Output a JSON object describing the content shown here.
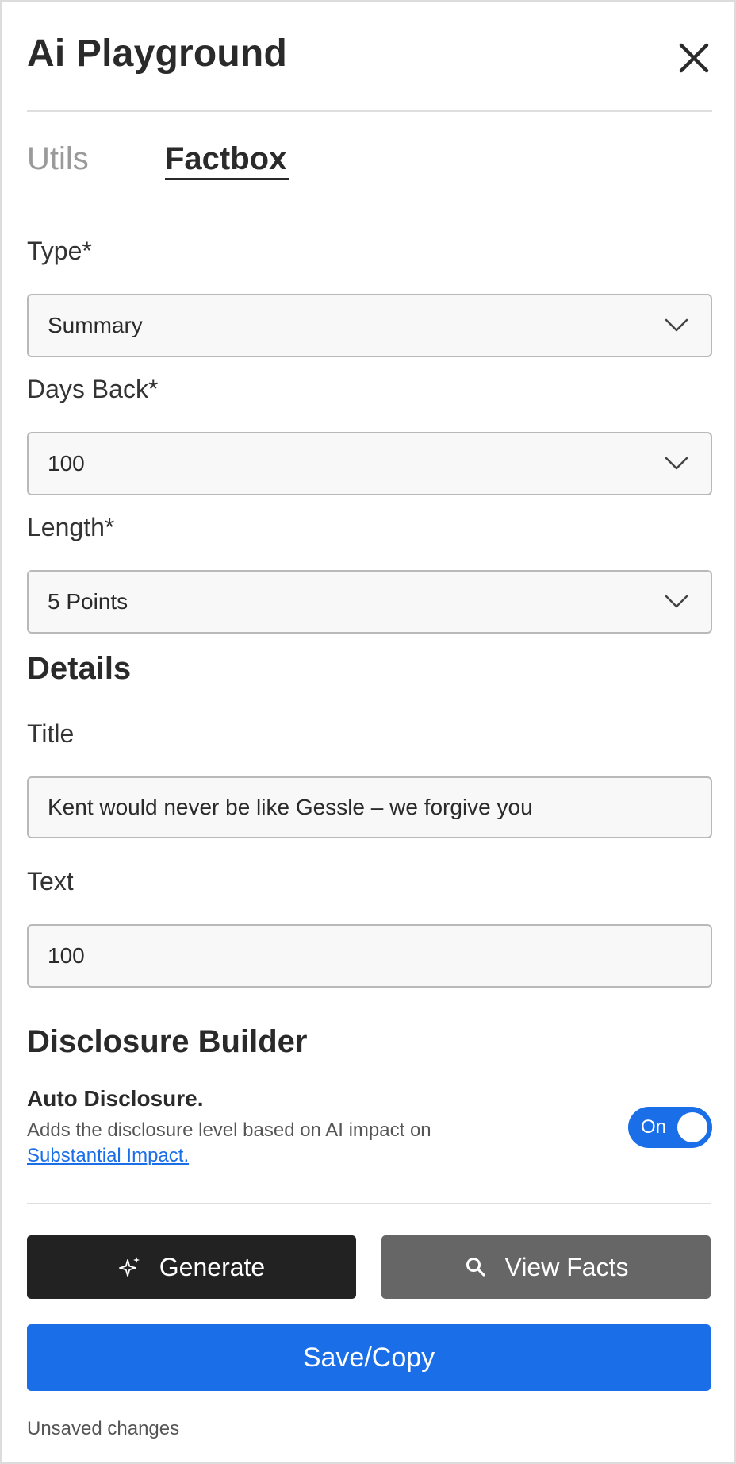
{
  "header": {
    "title": "Ai Playground",
    "close_icon": "close-icon"
  },
  "tabs": [
    {
      "label": "Utils",
      "active": false
    },
    {
      "label": "Factbox",
      "active": true
    }
  ],
  "form": {
    "type": {
      "label": "Type*",
      "value": "Summary"
    },
    "days_back": {
      "label": "Days Back*",
      "value": "100"
    },
    "length": {
      "label": "Length*",
      "value": "5 Points"
    }
  },
  "details": {
    "heading": "Details",
    "title_field": {
      "label": "Title",
      "value": "Kent would never be like Gessle – we forgive you"
    },
    "text_field": {
      "label": "Text",
      "value": "100"
    }
  },
  "disclosure": {
    "heading": "Disclosure Builder",
    "auto_label": "Auto Disclosure.",
    "description": "Adds the disclosure level based on AI impact on",
    "link_text": "Substantial Impact.",
    "toggle_label": "On",
    "toggle_on": true
  },
  "actions": {
    "generate_label": "Generate",
    "generate_icon": "sparkle-icon",
    "view_facts_label": "View Facts",
    "view_facts_icon": "search-icon",
    "save_label": "Save/Copy"
  },
  "status": {
    "unsaved_text": "Unsaved changes"
  },
  "colors": {
    "accent_blue": "#1a6ee8",
    "generate_bg": "#222222",
    "view_facts_bg": "#666666",
    "text_primary": "#2a2a2a"
  }
}
